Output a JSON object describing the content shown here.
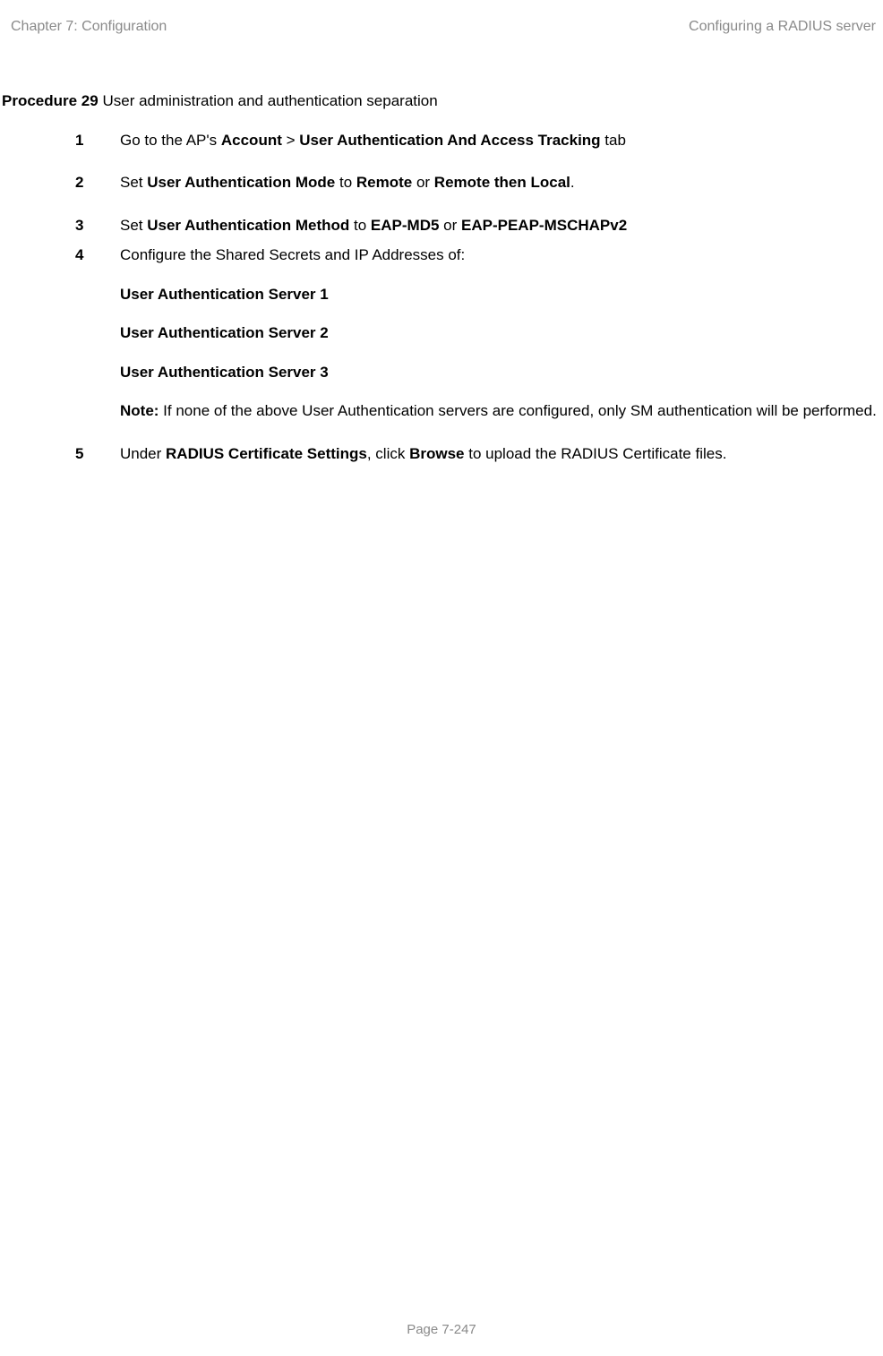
{
  "header": {
    "left": "Chapter 7:  Configuration",
    "right": "Configuring a RADIUS server"
  },
  "procedure": {
    "label": "Procedure 29",
    "title": " User administration and authentication separation"
  },
  "steps": {
    "s1": {
      "num": "1",
      "pre": "Go to the AP's ",
      "account": "Account",
      "gt": " > ",
      "tab": "User Authentication And Access Tracking",
      "post": " tab"
    },
    "s2": {
      "num": "2",
      "pre": "Set ",
      "mode": "User Authentication Mode",
      "to": " to ",
      "remote": "Remote",
      "or": " or ",
      "rtl": "Remote then Local",
      "period": "."
    },
    "s3": {
      "num": "3",
      "pre": "Set ",
      "method": "User Authentication Method",
      "to": " to ",
      "md5": "EAP-MD5",
      "or": " or ",
      "peap": "EAP-PEAP-MSCHAPv2"
    },
    "s4": {
      "num": "4",
      "line1": "Configure the Shared Secrets and IP Addresses of:",
      "uas1": "User Authentication Server 1",
      "uas2": "User Authentication Server 2",
      "uas3": "User Authentication Server 3",
      "note_label": "Note:",
      "note_text": " If none of the above User Authentication servers are configured, only SM authentication will be performed."
    },
    "s5": {
      "num": "5",
      "pre": "Under ",
      "rcs": "RADIUS Certificate Settings",
      "mid": ", click ",
      "browse": "Browse",
      "post": " to upload the RADIUS Certificate files."
    }
  },
  "footer": "Page 7-247"
}
